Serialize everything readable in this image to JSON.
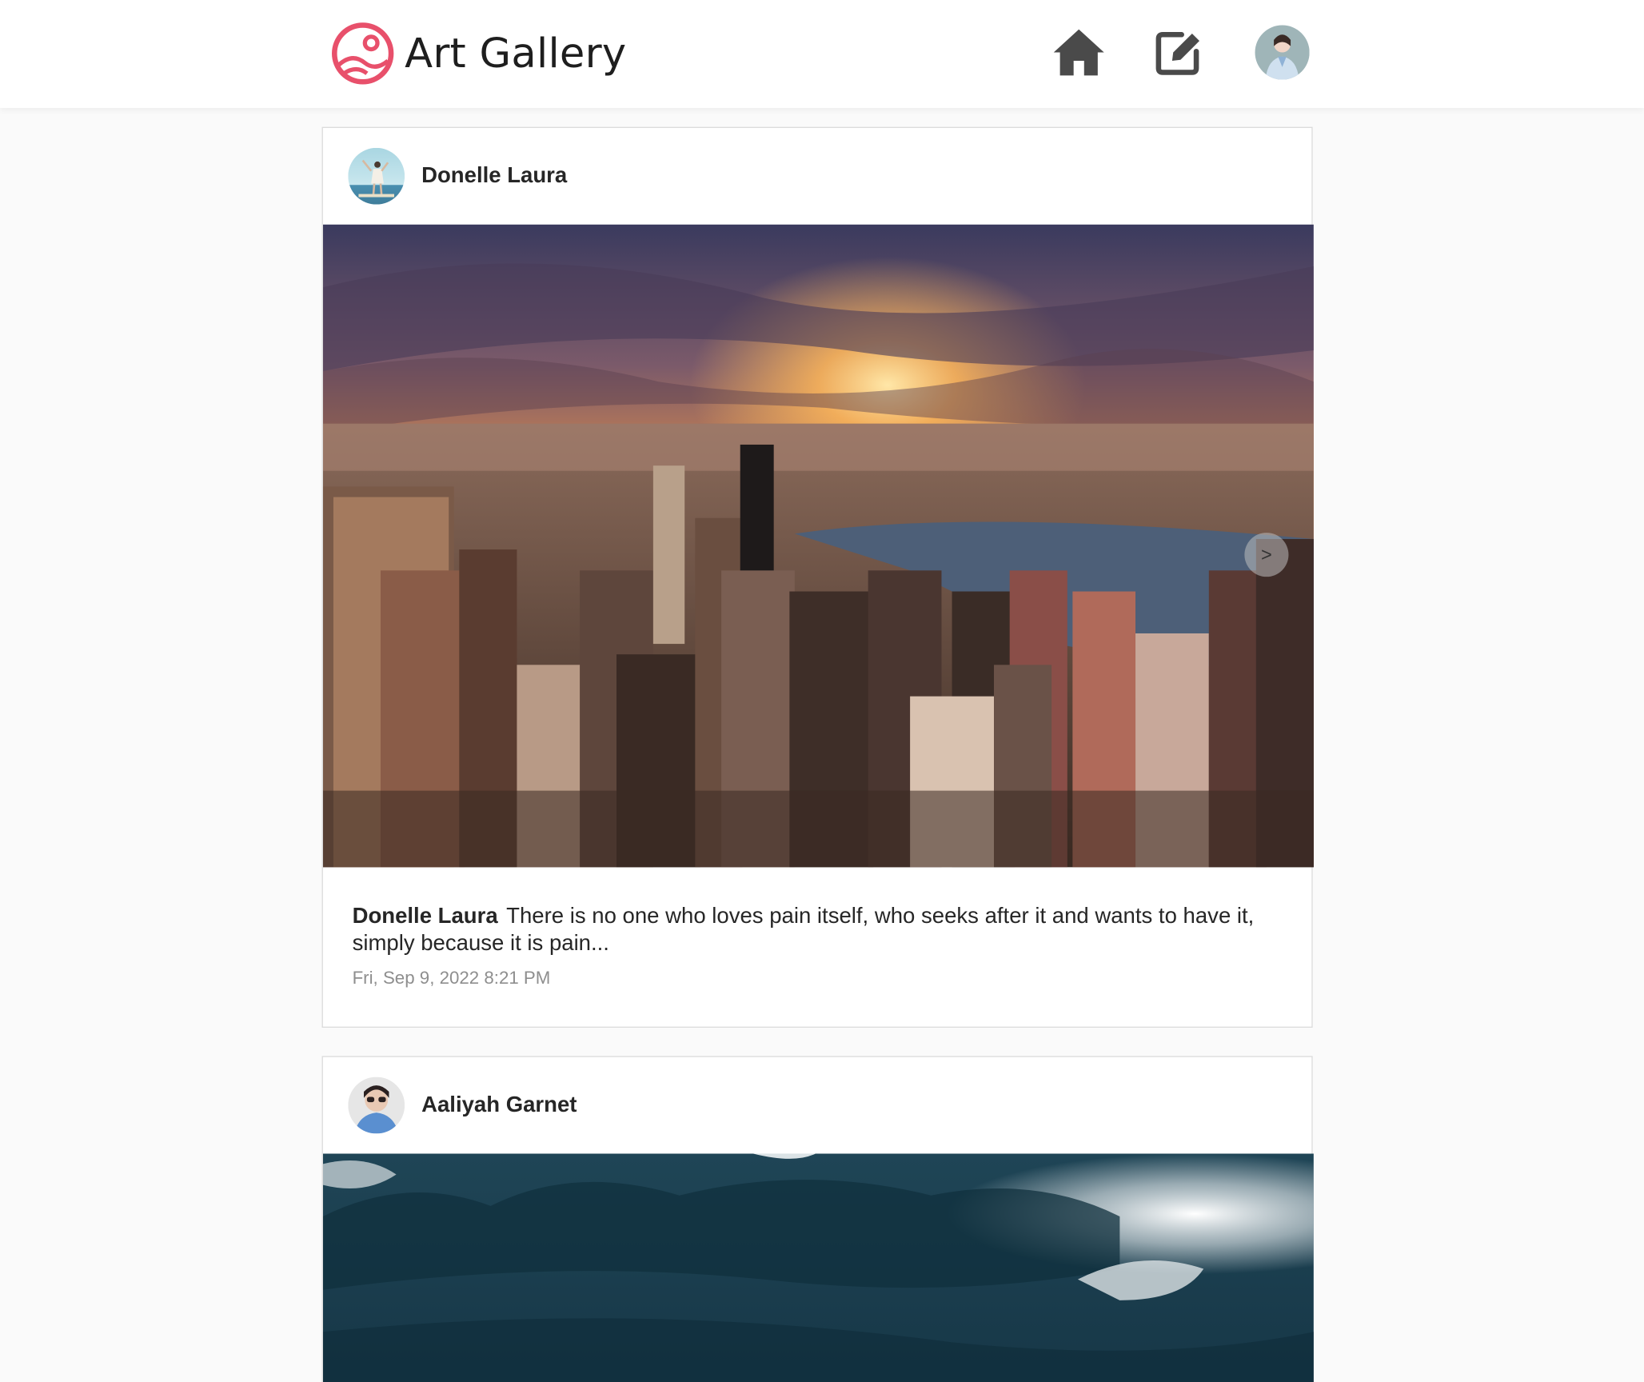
{
  "header": {
    "app_title": "Art Gallery",
    "logo_icon": "image-circle-icon",
    "brand_color": "#e8506b",
    "nav": {
      "home_icon": "home-icon",
      "edit_icon": "edit-icon",
      "profile_icon": "avatar"
    }
  },
  "posts": [
    {
      "author": "Donelle Laura",
      "caption_author": "Donelle Laura",
      "caption": "There is no one who loves pain itself, who seeks after it and wants to have it, simply because it is pain...",
      "timestamp": "Fri, Sep 9, 2022 8:21 PM",
      "next_label": ">"
    },
    {
      "author": "Aaliyah Garnet"
    }
  ]
}
